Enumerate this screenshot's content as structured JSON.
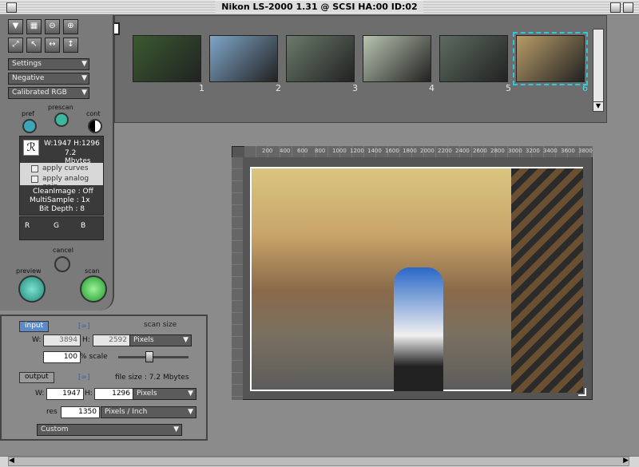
{
  "window": {
    "title": "Nikon LS-2000 1.31 @ SCSI HA:00 ID:02"
  },
  "filmstrip": {
    "frames": [
      {
        "num": "1",
        "color": "#3a5a30"
      },
      {
        "num": "2",
        "color": "#7fa6c8"
      },
      {
        "num": "3",
        "color": "#6a7a6a"
      },
      {
        "num": "4",
        "color": "#b8c4b0"
      },
      {
        "num": "5",
        "color": "#5d6b60"
      },
      {
        "num": "6",
        "color": "#b89c68"
      }
    ],
    "selected": "6"
  },
  "toolbar": {
    "tools": [
      "▼",
      "▦",
      "⊖",
      "⊕",
      "⤢",
      "↖",
      "↔",
      "↕"
    ]
  },
  "dropdowns": {
    "settings": "Settings",
    "film": "Negative",
    "color": "Calibrated RGB"
  },
  "controls": {
    "pref": "pref",
    "prescan": "prescan",
    "cont": "cont",
    "cancel": "cancel",
    "preview": "preview",
    "scan": "scan"
  },
  "info": {
    "wh": "W:1947  H:1296",
    "size": "7.2 Mbytes",
    "apply_curves": "apply curves",
    "apply_gain": "apply analog gain",
    "clean": "CleanImage : Off",
    "multi": "MultiSample : 1x",
    "depth": "Bit Depth :   8",
    "r": "R",
    "g": "G",
    "b": "B"
  },
  "size": {
    "input_tag": "input",
    "scan_size": "scan size",
    "w_label": "W:",
    "h_label": "H:",
    "input_w": "3894",
    "input_h": "2592",
    "input_unit": "Pixels",
    "scale": "100",
    "scale_label": "% scale",
    "output_tag": "output",
    "file_size": "file size : 7.2 Mbytes",
    "output_w": "1947",
    "output_h": "1296",
    "output_unit": "Pixels",
    "res_label": "res",
    "res": "1350",
    "res_unit": "Pixels / Inch",
    "preset": "Custom"
  },
  "ruler": {
    "ticks": [
      "200",
      "400",
      "600",
      "800",
      "1000",
      "1200",
      "1400",
      "1600",
      "1800",
      "2000",
      "2200",
      "2400",
      "2600",
      "2800",
      "3000",
      "3200",
      "3400",
      "3600",
      "3800"
    ]
  }
}
